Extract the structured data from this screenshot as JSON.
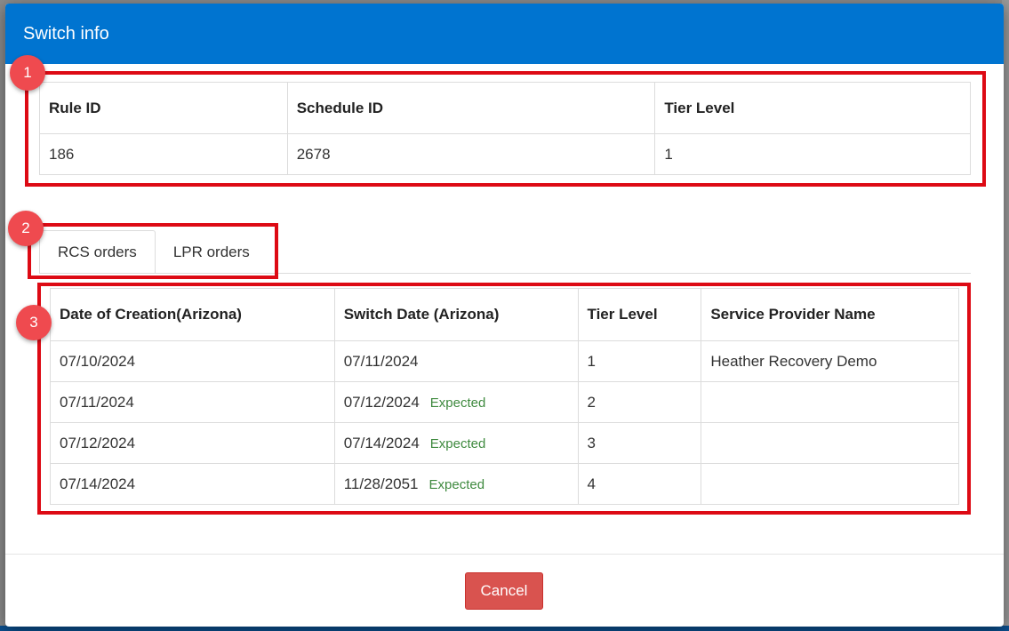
{
  "modal": {
    "title": "Switch info"
  },
  "info_table": {
    "headers": [
      "Rule ID",
      "Schedule ID",
      "Tier Level"
    ],
    "row": [
      "186",
      "2678",
      "1"
    ]
  },
  "tabs": [
    {
      "label": "RCS orders",
      "active": true
    },
    {
      "label": "LPR orders",
      "active": false
    }
  ],
  "orders_table": {
    "headers": [
      "Date of Creation(Arizona)",
      "Switch Date (Arizona)",
      "Tier Level",
      "Service Provider Name"
    ],
    "rows": [
      {
        "created": "07/10/2024",
        "switch_date": "07/11/2024",
        "status": "",
        "tier": "1",
        "provider": "Heather Recovery Demo"
      },
      {
        "created": "07/11/2024",
        "switch_date": "07/12/2024",
        "status": "Expected",
        "tier": "2",
        "provider": ""
      },
      {
        "created": "07/12/2024",
        "switch_date": "07/14/2024",
        "status": "Expected",
        "tier": "3",
        "provider": ""
      },
      {
        "created": "07/14/2024",
        "switch_date": "11/28/2051",
        "status": "Expected",
        "tier": "4",
        "provider": ""
      }
    ]
  },
  "annotations": [
    "1",
    "2",
    "3"
  ],
  "footer": {
    "cancel_label": "Cancel"
  },
  "colors": {
    "header_bg": "#0074d0",
    "highlight": "#dd0a14",
    "badge": "#ef4a4f",
    "expected_text": "#3f8a3f",
    "cancel_bg": "#d9534f"
  }
}
